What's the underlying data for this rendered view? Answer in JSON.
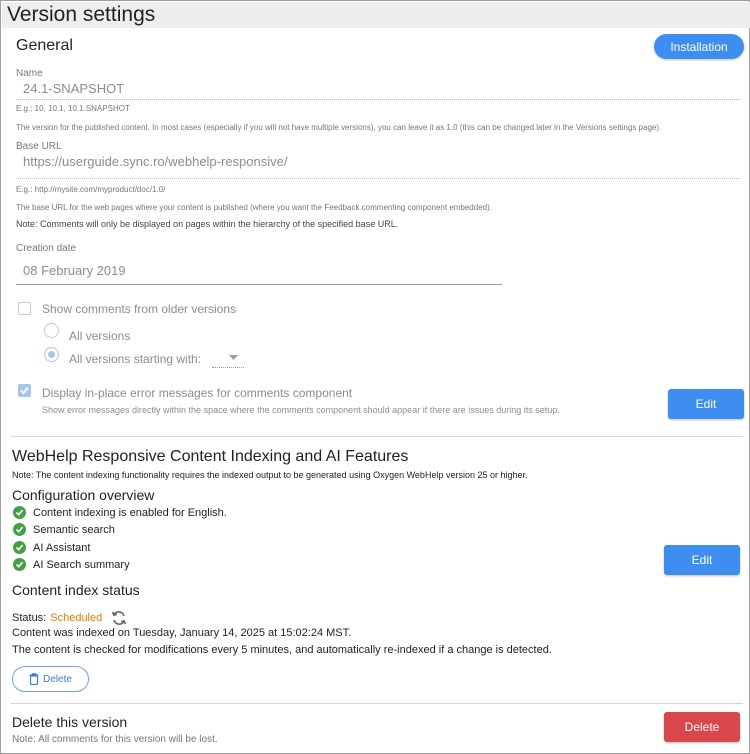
{
  "page": {
    "title": "Version settings"
  },
  "general": {
    "title": "General",
    "installation_label": "Installation",
    "name": {
      "label": "Name",
      "value": "24.1-SNAPSHOT",
      "example": "E.g.: 10, 10.1, 10.1.SNAPSHOT",
      "help": "The version for the published content. In most cases (especially if you will not have multiple versions), you can leave it as 1.0 (this can be changed later in the Versions settings page)."
    },
    "base_url": {
      "label": "Base URL",
      "value": "https://userguide.sync.ro/webhelp-responsive/",
      "example": "E.g.: http://mysite.com/myproduct/doc/1.0/",
      "help": "The base URL for the web pages where your content is published (where you want the Feedback commenting component embedded).",
      "note": "Note: Comments will only be displayed on pages within the hierarchy of the specified base URL."
    },
    "creation_date": {
      "label": "Creation date",
      "value": "08 February 2019"
    },
    "show_older": {
      "label": "Show comments from older versions",
      "checked": false,
      "options": [
        {
          "label": "All versions",
          "selected": false
        },
        {
          "label": "All versions starting with:",
          "selected": true
        }
      ]
    },
    "display_errors": {
      "label": "Display in-place error messages for comments component",
      "description": "Show error messages directly within the space where the comments component should appear if there are issues during its setup.",
      "checked": true
    },
    "edit_label": "Edit"
  },
  "indexing": {
    "title": "WebHelp Responsive Content Indexing and AI Features",
    "note": "Note: The content indexing functionality requires the indexed output to be generated using Oxygen WebHelp version 25 or higher.",
    "overview_title": "Configuration overview",
    "overview_items": [
      "Content indexing is enabled for English.",
      "Semantic search",
      "AI Assistant",
      "AI Search summary"
    ],
    "edit_label": "Edit",
    "status_title": "Content index status",
    "status_prefix": "Status:",
    "status_value": "Scheduled",
    "indexed_on": "Content was indexed on Tuesday, January 14, 2025 at 15:02:24 MST.",
    "check_info": "The content is checked for modifications every 5 minutes, and automatically re-indexed if a change is detected.",
    "delete_label": "Delete"
  },
  "delete_version": {
    "title": "Delete this version",
    "note": "Note: All comments for this version will be lost.",
    "button_label": "Delete"
  },
  "colors": {
    "primary": "#3d8ef0",
    "danger": "#d9464c",
    "success": "#43a047",
    "status_scheduled": "#e07b00"
  },
  "icons": {
    "ok": "check-circle-icon",
    "refresh": "refresh-icon",
    "trash": "trash-icon",
    "dropdown": "caret-down-icon"
  }
}
